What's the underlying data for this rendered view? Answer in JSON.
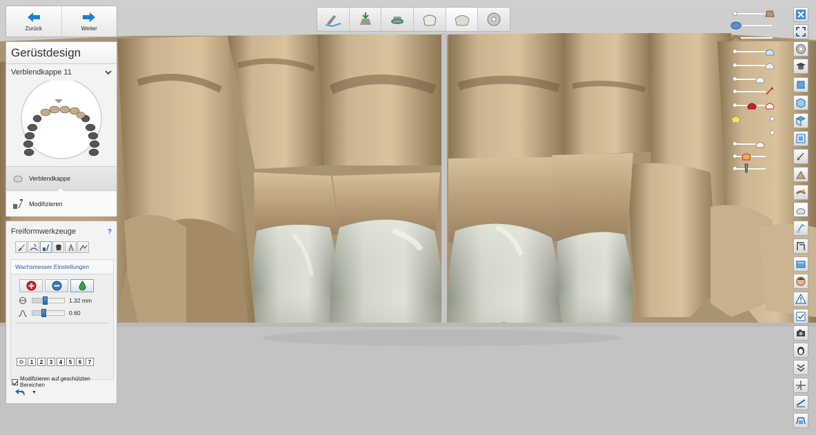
{
  "nav": {
    "back_label": "Zurück",
    "next_label": "Weiter"
  },
  "design": {
    "title": "Gerüstdesign",
    "restoration": "Verblendkappe 11",
    "steps": [
      {
        "label": "Verblendkappe"
      },
      {
        "label": "Modifizieren"
      }
    ]
  },
  "tools": {
    "title": "Freiformwerkzeuge",
    "help": "?",
    "wax": {
      "title": "Wachsmesser Einstellungen",
      "size_value": "1.32 mm",
      "size_fraction": 0.4,
      "intensity_value": "0.60",
      "intensity_fraction": 0.33
    },
    "presets": [
      "1",
      "2",
      "3",
      "4",
      "5",
      "6",
      "7"
    ],
    "protect_label": "Modifizieren auf geschützten Bereichen",
    "protect_checked": true
  },
  "workflow": {
    "steps": [
      "Verwaltung",
      "Präparation",
      "Präparationsgrenze",
      "Einschubachse",
      "Gerüstdesign",
      "Fräsvorschau"
    ],
    "current_index": 4
  },
  "colors": {
    "accent": "#2d6aa9",
    "tooth_body": "#c8b08a",
    "crown": "#c9cdc0",
    "background": "#c6c6c6"
  }
}
